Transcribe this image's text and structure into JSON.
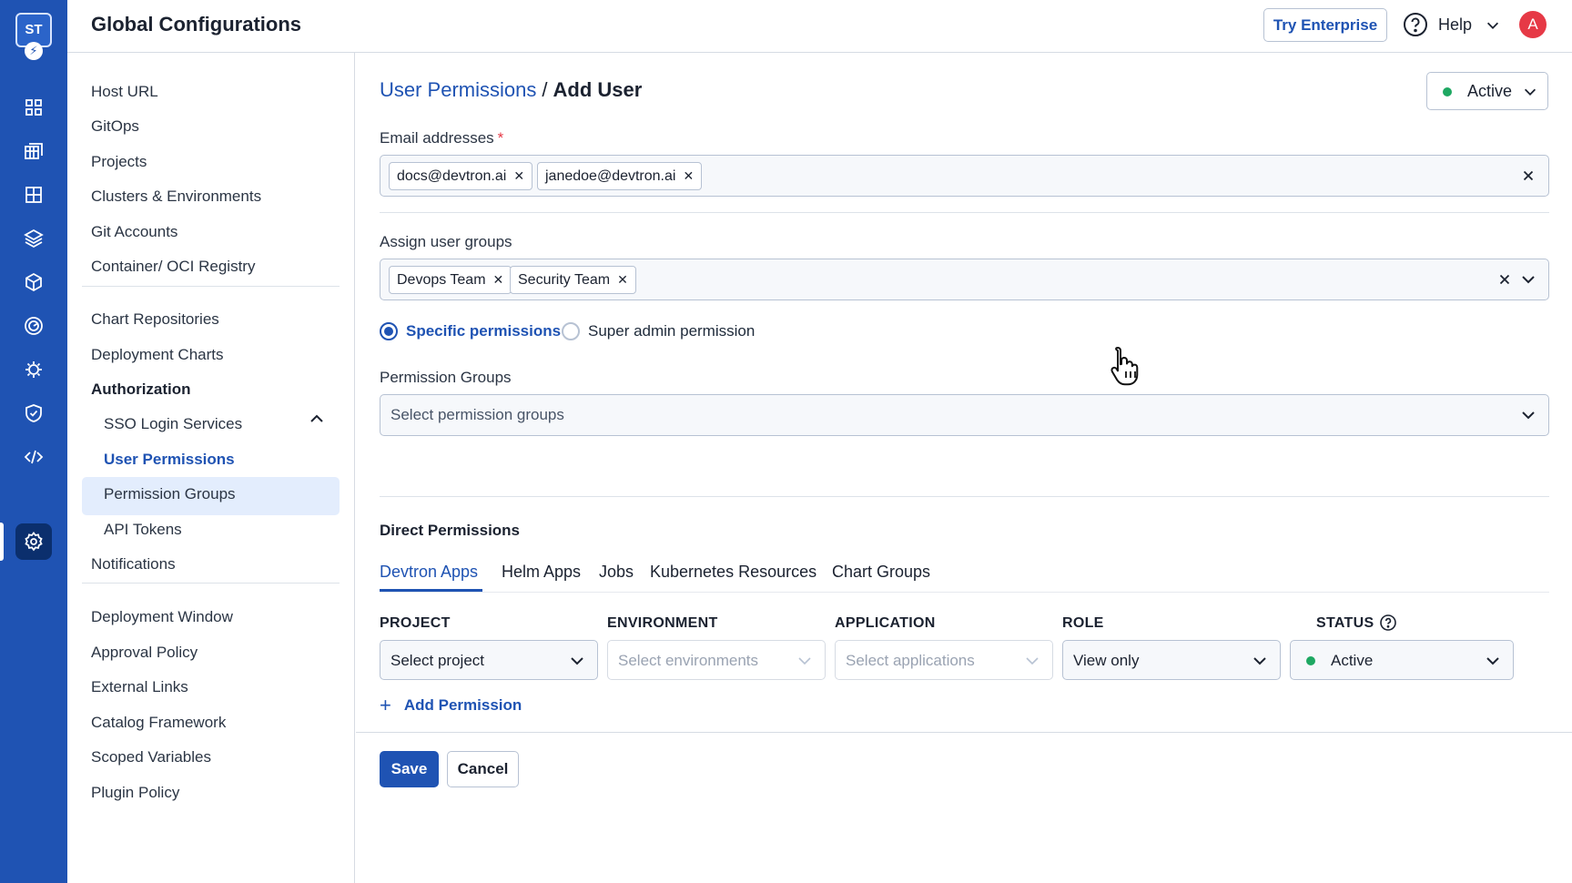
{
  "app": {
    "logo_text": "ST",
    "title": "Global Configurations"
  },
  "header": {
    "try_enterprise": "Try Enterprise",
    "help_label": "Help",
    "avatar_initial": "A"
  },
  "rail": {
    "icons": [
      "apps-grid-icon",
      "app-groups-icon",
      "resource-browser-icon",
      "stack-layers-icon",
      "cube-icon",
      "target-icon",
      "bug-icon",
      "shield-check-icon",
      "code-icon",
      "settings-gear-icon"
    ],
    "active_icon": "settings-gear-icon"
  },
  "sidebar": {
    "group1": [
      "Host URL",
      "GitOps",
      "Projects",
      "Clusters & Environments",
      "Git Accounts",
      "Container/ OCI Registry"
    ],
    "group2": [
      "Chart Repositories",
      "Deployment Charts"
    ],
    "authorization": "Authorization",
    "auth_children": [
      "SSO Login Services",
      "User Permissions",
      "Permission Groups",
      "API Tokens"
    ],
    "notifications": "Notifications",
    "group3": [
      "Deployment Window",
      "Approval Policy",
      "External Links",
      "Catalog Framework",
      "Scoped Variables",
      "Plugin Policy"
    ]
  },
  "breadcrumb": {
    "parent": "User Permissions",
    "separator": "/",
    "current": "Add User"
  },
  "status_top": {
    "label": "Active",
    "color": "#1ea862"
  },
  "email": {
    "label": "Email addresses",
    "required_mark": "*",
    "chips": [
      "docs@devtron.ai",
      "janedoe@devtron.ai"
    ]
  },
  "groups": {
    "label": "Assign user groups",
    "chips": [
      "Devops Team",
      "Security Team"
    ]
  },
  "permission_type": {
    "options": [
      "Specific permissions",
      "Super admin permission"
    ],
    "selected": "Specific permissions"
  },
  "permission_groups": {
    "label": "Permission Groups",
    "placeholder": "Select permission groups"
  },
  "direct": {
    "title": "Direct Permissions",
    "tabs": [
      "Devtron Apps",
      "Helm Apps",
      "Jobs",
      "Kubernetes Resources",
      "Chart Groups"
    ],
    "active_tab": "Devtron Apps",
    "columns": [
      "PROJECT",
      "ENVIRONMENT",
      "APPLICATION",
      "ROLE",
      "STATUS"
    ],
    "row": {
      "project": "Select project",
      "environment": "Select environments",
      "application": "Select applications",
      "role": "View only",
      "status": "Active"
    },
    "add_permission": "Add Permission"
  },
  "footer": {
    "save": "Save",
    "cancel": "Cancel"
  },
  "colors": {
    "brand": "#1f53b3",
    "rail_active": "#0b2f6d",
    "danger": "#e63946",
    "success": "#1ea862"
  }
}
